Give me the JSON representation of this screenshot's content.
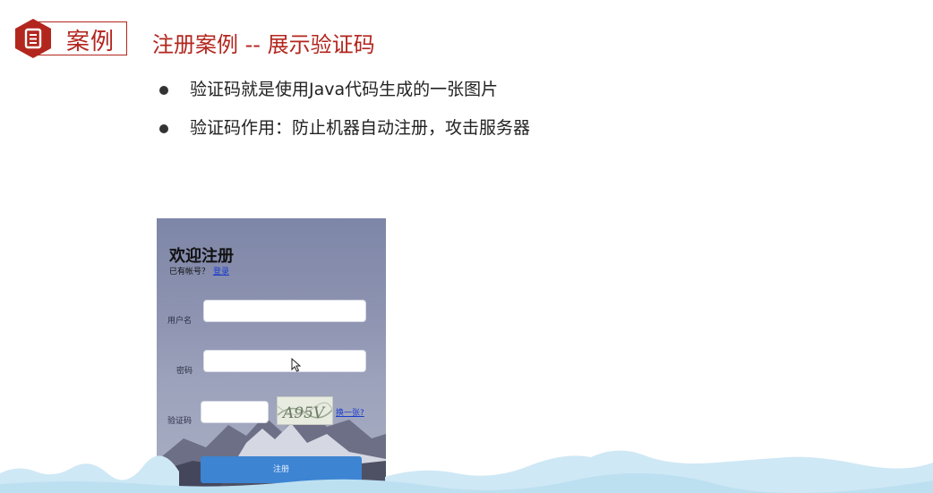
{
  "header": {
    "badge_icon": "document-icon",
    "badge_label": "案例",
    "title": "注册案例 -- 展示验证码",
    "accent_color": "#b3261e"
  },
  "bullets": [
    "验证码就是使用Java代码生成的一张图片",
    "验证码作用：防止机器自动注册，攻击服务器"
  ],
  "register_form": {
    "heading": "欢迎注册",
    "has_account_text": "已有帐号？",
    "login_link": "登录",
    "username_label": "用户名",
    "username_value": "",
    "password_label": "密码",
    "password_value": "",
    "captcha_label": "验证码",
    "captcha_value": "",
    "captcha_image_text": "A95V",
    "refresh_link": "换一张?",
    "submit_label": "注册",
    "button_color": "#3d84d2"
  }
}
